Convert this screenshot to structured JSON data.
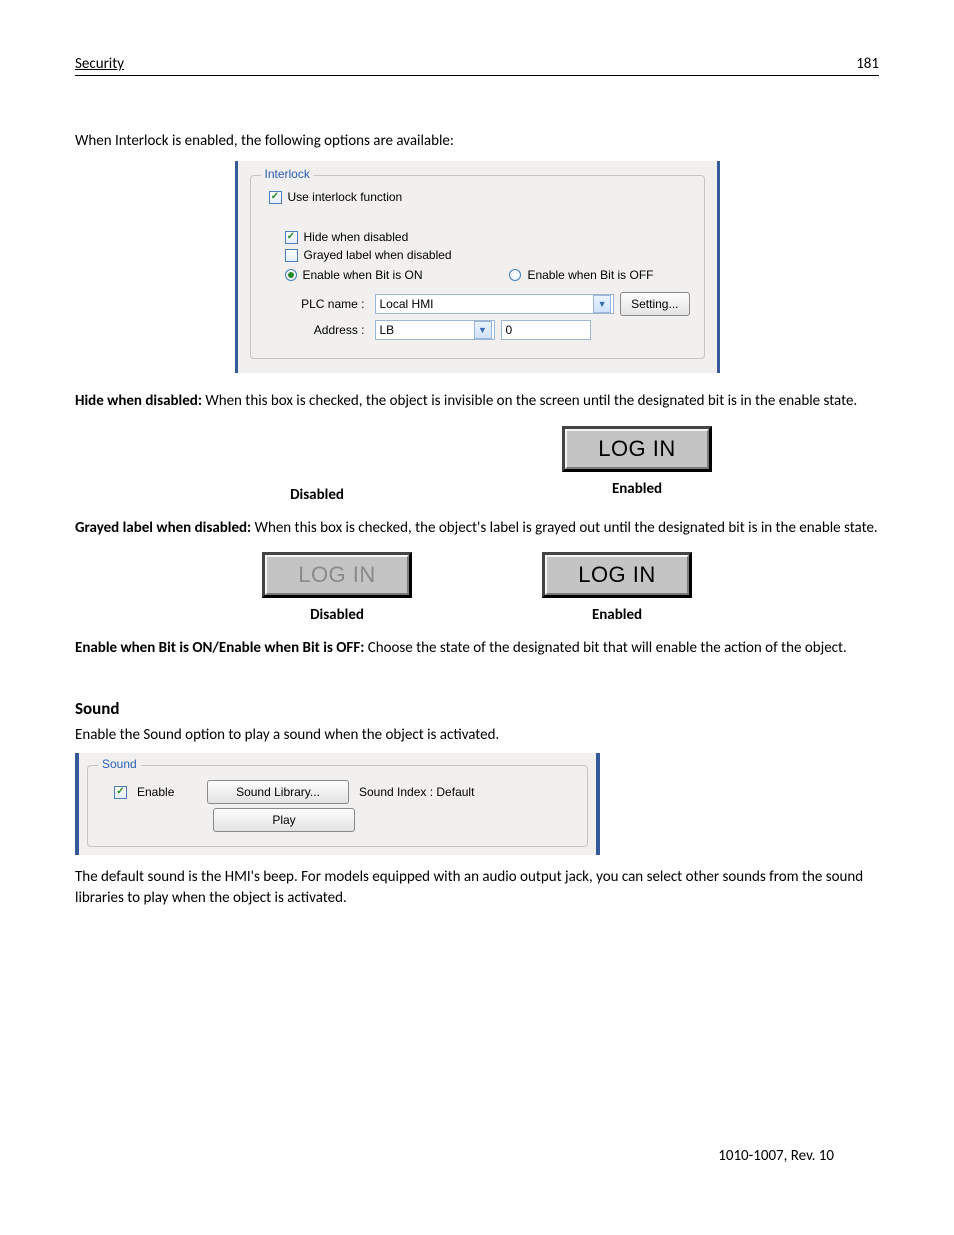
{
  "header": {
    "section": "Security",
    "page": "181"
  },
  "intro": "When Interlock is enabled, the following options are available:",
  "interlock": {
    "legend": "Interlock",
    "use_label": "Use interlock function",
    "hide_label": "Hide when disabled",
    "grayed_label": "Grayed label when disabled",
    "radio_on": "Enable when Bit is ON",
    "radio_off": "Enable when Bit is OFF",
    "plc_label": "PLC name :",
    "plc_value": "Local HMI",
    "setting_btn": "Setting...",
    "addr_label": "Address :",
    "addr_type": "LB",
    "addr_value": "0"
  },
  "hide_desc": {
    "bold": "Hide when disabled:",
    "text": " When this box is checked, the object is invisible on the screen until the designated bit is in the enable state."
  },
  "states": {
    "disabled": "Disabled",
    "enabled": "Enabled",
    "login": "LOG IN"
  },
  "grayed_desc": {
    "bold": "Grayed label when disabled:",
    "text": " When this box is checked, the object's label is grayed out until the designated bit is in the enable state."
  },
  "enable_desc": {
    "bold": "Enable when Bit is ON/Enable when Bit is OFF:",
    "text": " Choose the state of the designated bit that will enable the action of the object."
  },
  "sound": {
    "heading": "Sound",
    "intro": "Enable the Sound option to play a sound when the object is activated.",
    "legend": "Sound",
    "enable_label": "Enable",
    "library_btn": "Sound Library...",
    "index_label": "Sound Index : Default",
    "play_btn": "Play",
    "outro": "The default sound is the HMI's beep. For models equipped with an audio output jack, you can select other sounds from the sound libraries to play when the object is activated."
  },
  "footer": "1010-1007, Rev. 10"
}
